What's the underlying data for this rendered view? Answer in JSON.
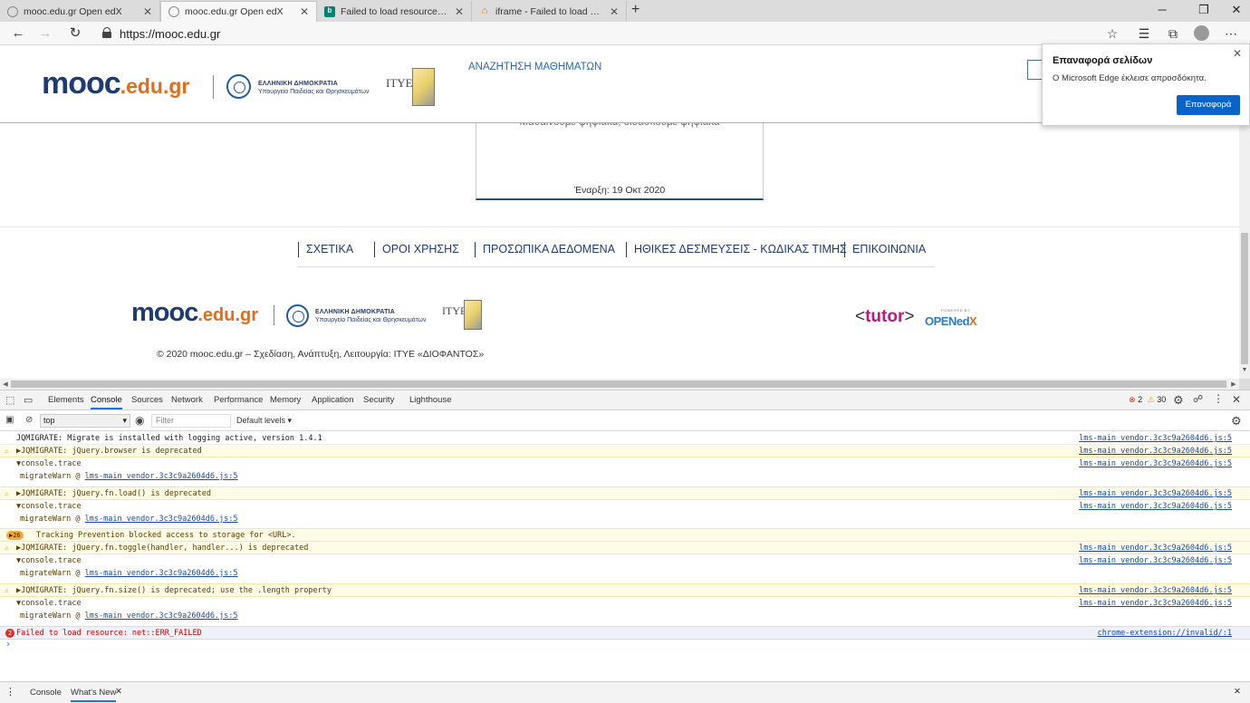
{
  "browser": {
    "tabs": [
      {
        "label": "mooc.edu.gr Open edX",
        "favicon": "globe-icon"
      },
      {
        "label": "mooc.edu.gr Open edX",
        "favicon": "globe-icon"
      },
      {
        "label": "Failed to load resource: net::ERR_",
        "favicon": "bing-icon"
      },
      {
        "label": "iframe - Failed to load resource:",
        "favicon": "iframe-icon"
      }
    ],
    "active_tab": 1,
    "url": "https://mooc.edu.gr"
  },
  "site": {
    "logo_main": "mooc",
    "logo_suffix": ".edu.gr",
    "gov_line1": "ΕΛΛΗΝΙΚΗ ΔΗΜΟΚΡΑΤΙΑ",
    "gov_line2": "Υπουργείο Παιδείας και Θρησκευμάτων",
    "itye": "ΙΤΥΕ",
    "search_link": "ΑΝΑΖΗΤΗΣΗ ΜΑΘΗΜΑΤΩΝ",
    "course_subtitle": "Μαθαίνουμε ψηφιακά, διδάσκουμε ψηφιακά",
    "course_date": "Έναρξη: 19 Οκτ 2020",
    "footer_links": [
      "ΣΧΕΤΙΚΑ",
      "ΟΡΟΙ ΧΡΗΣΗΣ",
      "ΠΡΟΣΩΠΙΚΑ ΔΕΔΟΜΕΝΑ",
      "ΗΘΙΚΕΣ ΔΕΣΜΕΥΣΕΙΣ - ΚΩΔΙΚΑΣ ΤΙΜΗΣ",
      "ΕΠΙΚΟΙΝΩΝΙΑ"
    ],
    "copyright": "© 2020 mooc.edu.gr – Σχεδίαση, Ανάπτυξη, Λειτουργία: ΙΤΥΕ «ΔΙΟΦΑΝΤΟΣ»",
    "tutor": "tutor",
    "powered_by": "POWERED BY",
    "openedx_open": "OPEN",
    "openedx_ed": "ed",
    "openedx_x": "X"
  },
  "restore_popup": {
    "title": "Επαναφορά σελίδων",
    "message": "Ο Microsoft Edge έκλεισε απροσδόκητα.",
    "button": "Επαναφορά"
  },
  "devtools": {
    "tabs": [
      "Elements",
      "Console",
      "Sources",
      "Network",
      "Performance",
      "Memory",
      "Application",
      "Security",
      "Lighthouse"
    ],
    "active_tab": "Console",
    "error_count": "2",
    "warning_count": "30",
    "context": "top",
    "filter_placeholder": "Filter",
    "levels": "Default levels ▾",
    "messages": [
      {
        "type": "log",
        "text": "JQMIGRATE: Migrate is installed with logging active, version 1.4.1",
        "source": "lms-main_vendor.3c3c9a2604d6.js:5"
      },
      {
        "type": "warn",
        "text": "▶JQMIGRATE: jQuery.browser is deprecated",
        "source": "lms-main_vendor.3c3c9a2604d6.js:5"
      },
      {
        "type": "trace",
        "text": "▼console.trace",
        "source": "lms-main_vendor.3c3c9a2604d6.js:5",
        "detail": "migrateWarn @ ",
        "detail_link": "lms-main_vendor.3c3c9a2604d6.js:5"
      },
      {
        "type": "warn",
        "text": "▶JQMIGRATE: jQuery.fn.load() is deprecated",
        "source": "lms-main_vendor.3c3c9a2604d6.js:5"
      },
      {
        "type": "trace",
        "text": "▼console.trace",
        "source": "lms-main_vendor.3c3c9a2604d6.js:5",
        "detail": "migrateWarn @ ",
        "detail_link": "lms-main_vendor.3c3c9a2604d6.js:5"
      },
      {
        "type": "group",
        "badge": "▶26",
        "text": "Tracking Prevention blocked access to storage for <URL>.",
        "source": ""
      },
      {
        "type": "warn",
        "text": "▶JQMIGRATE: jQuery.fn.toggle(handler, handler...) is deprecated",
        "source": "lms-main_vendor.3c3c9a2604d6.js:5"
      },
      {
        "type": "trace",
        "text": "▼console.trace",
        "source": "lms-main_vendor.3c3c9a2604d6.js:5",
        "detail": "migrateWarn @ ",
        "detail_link": "lms-main_vendor.3c3c9a2604d6.js:5"
      },
      {
        "type": "warn",
        "text": "▶JQMIGRATE: jQuery.fn.size() is deprecated; use the .length property",
        "source": "lms-main_vendor.3c3c9a2604d6.js:5"
      },
      {
        "type": "trace",
        "text": "▼console.trace",
        "source": "lms-main_vendor.3c3c9a2604d6.js:5",
        "detail": "migrateWarn @ ",
        "detail_link": "lms-main_vendor.3c3c9a2604d6.js:5"
      },
      {
        "type": "error",
        "badge": "2",
        "text": "Failed to load resource: net::ERR_FAILED",
        "source": "chrome-extension://invalid/:1"
      }
    ],
    "prompt": "›",
    "drawer_tabs": [
      "Console",
      "What's New"
    ]
  }
}
